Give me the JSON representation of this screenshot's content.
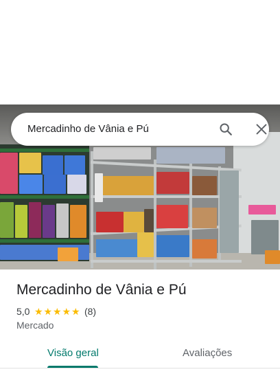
{
  "search": {
    "query": "Mercadinho de Vânia e Pú"
  },
  "icons": {
    "search": "search-icon",
    "close": "close-icon",
    "star": "star-icon"
  },
  "place": {
    "name": "Mercadinho de Vânia e Pú",
    "rating": "5,0",
    "stars": 5,
    "review_count": "(8)",
    "category": "Mercado"
  },
  "tabs": [
    {
      "label": "Visão geral",
      "active": true
    },
    {
      "label": "Avaliações",
      "active": false
    }
  ],
  "colors": {
    "accent": "#00796b",
    "star": "#fbbc04",
    "text_primary": "#202124",
    "text_secondary": "#5f6368"
  }
}
